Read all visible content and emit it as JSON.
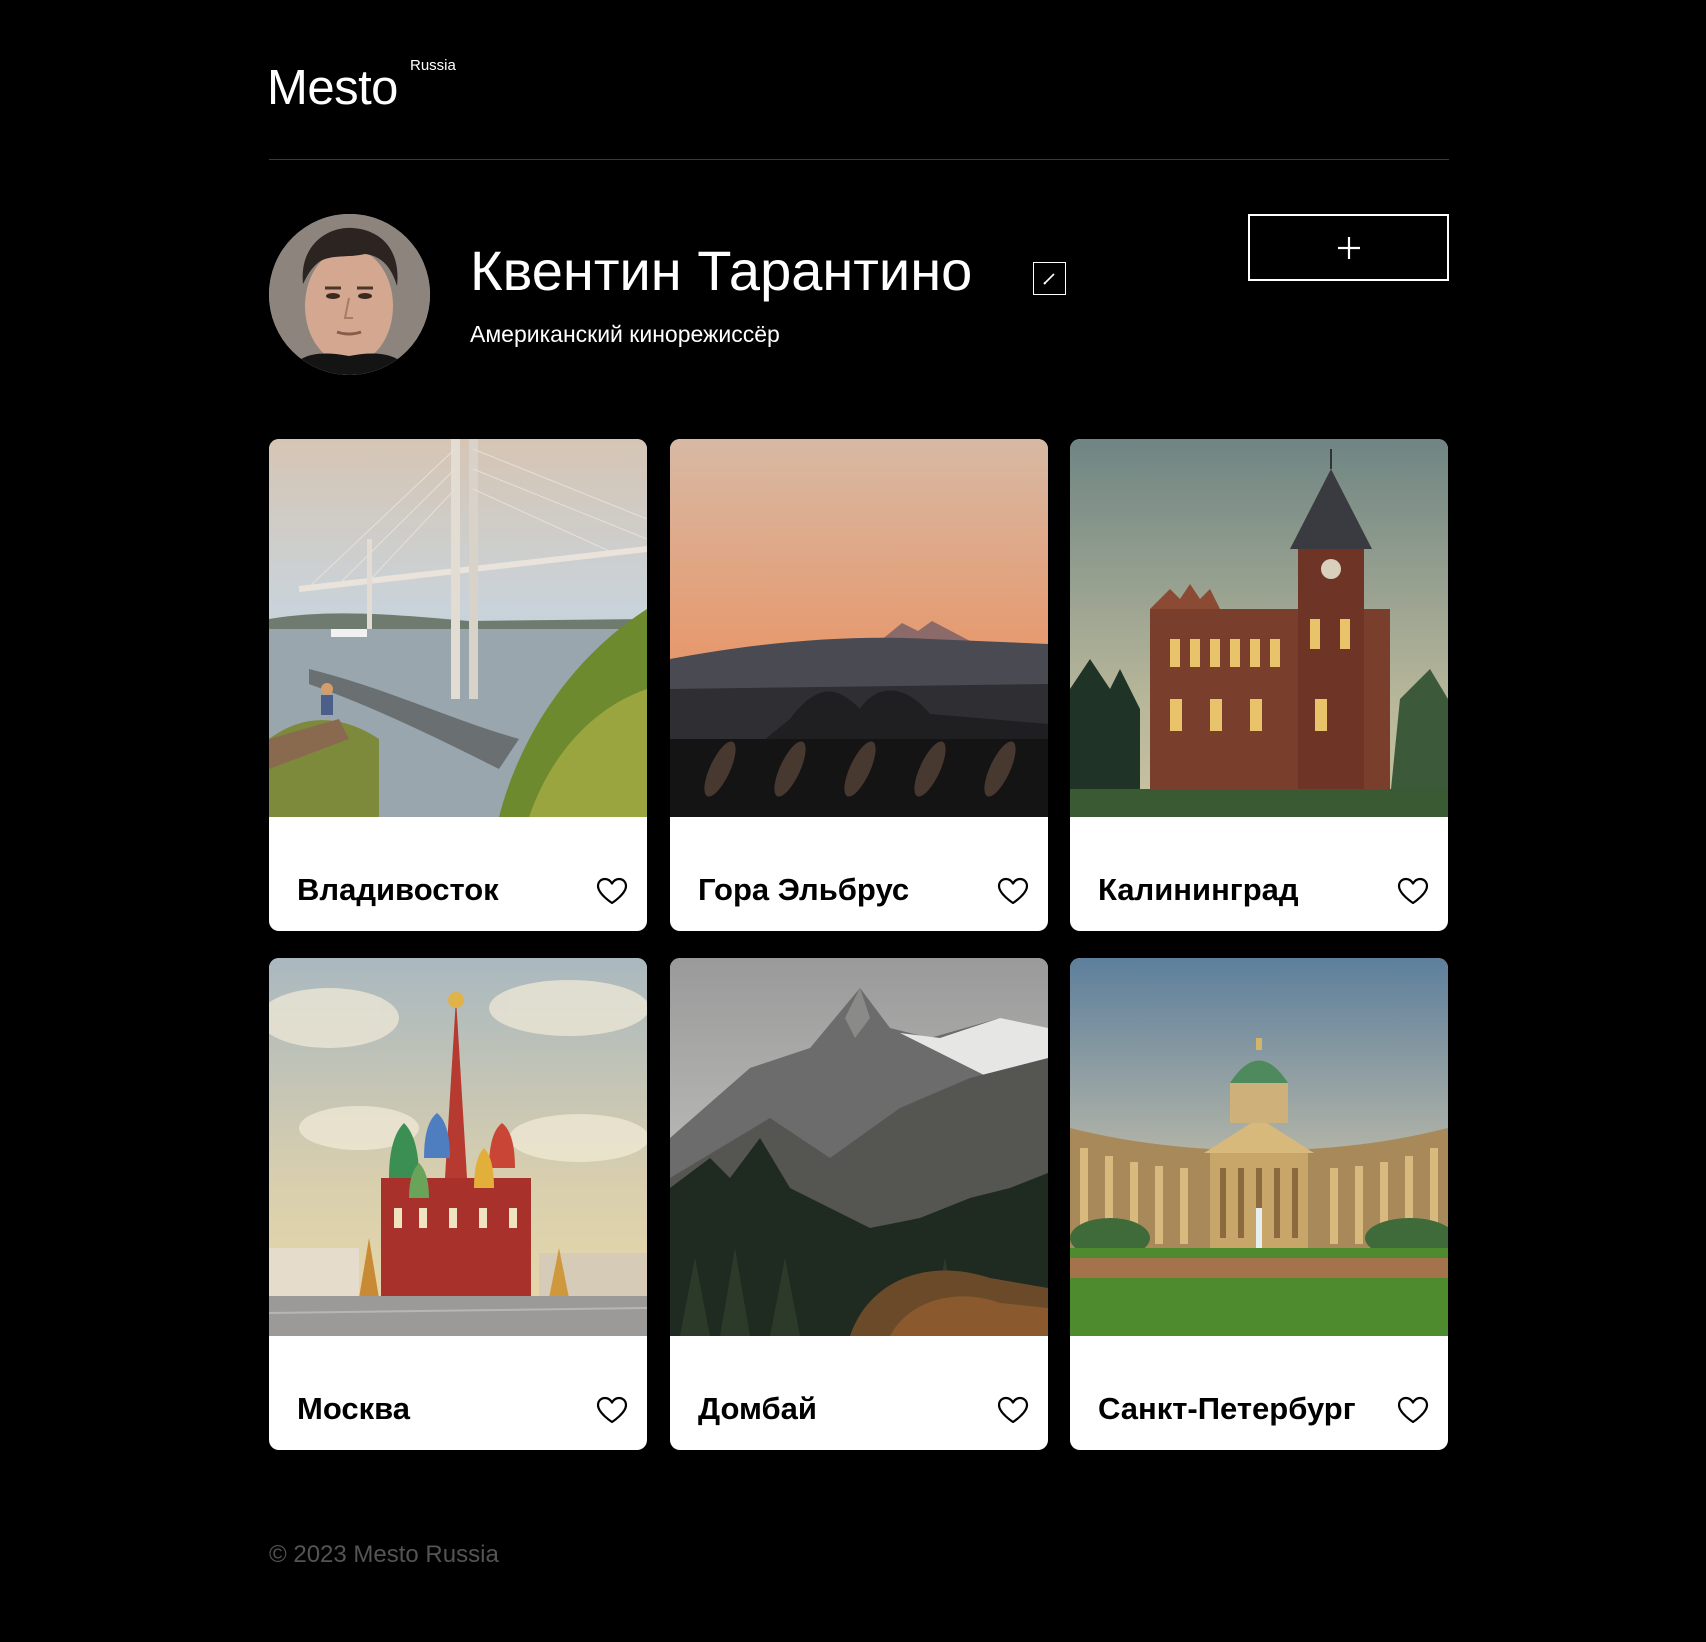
{
  "header": {
    "logo_word": "Mesto",
    "logo_sup": "Russia"
  },
  "profile": {
    "name": "Квентин Тарантино",
    "about": "Американский кинорежиссёр",
    "add_button_icon": "plus-icon",
    "edit_button_icon": "pencil-icon"
  },
  "cards": [
    {
      "title": "Владивосток"
    },
    {
      "title": "Гора Эльбрус"
    },
    {
      "title": "Калининград"
    },
    {
      "title": "Москва"
    },
    {
      "title": "Домбай"
    },
    {
      "title": "Санкт-Петербург"
    }
  ],
  "footer": {
    "copyright": "© 2023 Mesto Russia"
  },
  "colors": {
    "background": "#000000",
    "text": "#ffffff",
    "card_bg": "#ffffff",
    "footer_text": "#545454"
  }
}
